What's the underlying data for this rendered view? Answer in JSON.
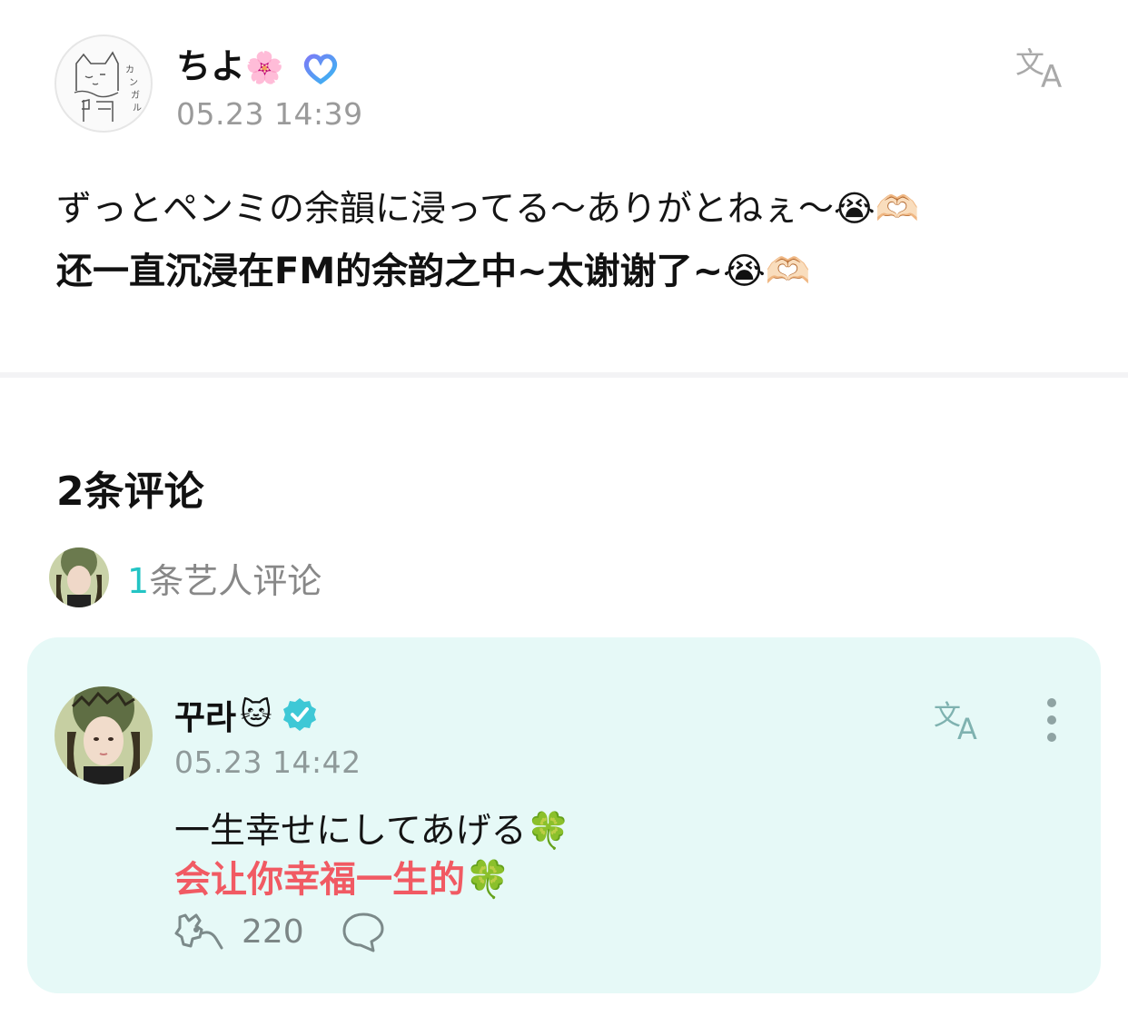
{
  "post": {
    "author": {
      "name": "ちよ",
      "name_emoji": "🌸",
      "badge_icon": "heart-badge-icon",
      "avatar_icon": "cat-sketch-avatar"
    },
    "time": "05.23 14:39",
    "translate_icon": "translate-icon",
    "text_original": "ずっとペンミの余韻に浸ってる～ありがとねぇ～😭🫶🏻",
    "text_translated": "还一直沉浸在FM的余韵之中~太谢谢了~😭🫶🏻"
  },
  "comments_section": {
    "count_label": "2条评论",
    "artist_summary": {
      "count": "1",
      "label": "条艺人评论"
    }
  },
  "comment": {
    "author": {
      "name": "꾸라",
      "name_emoji": "🐱",
      "verified_icon": "verified-check-icon"
    },
    "time": "05.23 14:42",
    "text_original": "一生幸せにしてあげる🍀",
    "text_translated": "会让你幸福一生的🍀",
    "like_count": "220",
    "colors": {
      "card_background": "#e6f9f7",
      "translated_text": "#f15a63",
      "accent": "#23c4c4"
    }
  }
}
